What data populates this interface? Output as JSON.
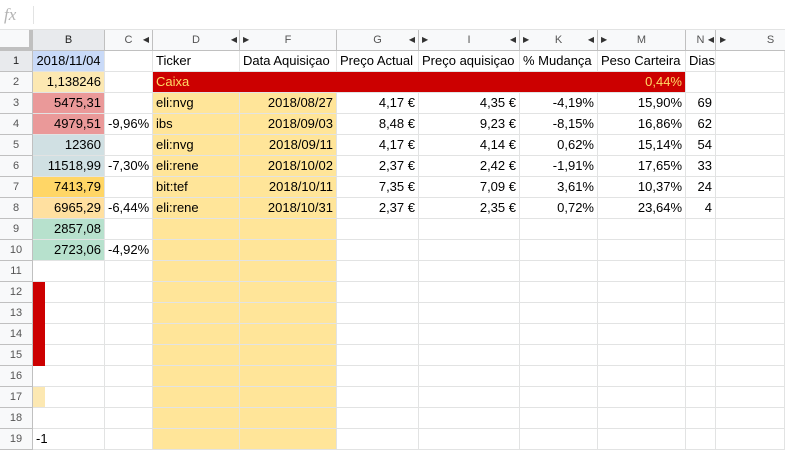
{
  "formula_bar": {
    "fx_label": "fx",
    "value": ""
  },
  "columns": [
    "B",
    "C",
    "D",
    "F",
    "G",
    "I",
    "K",
    "M",
    "N",
    "S"
  ],
  "rows": [
    "1",
    "2",
    "3",
    "4",
    "5",
    "6",
    "7",
    "8",
    "9",
    "10",
    "11",
    "12",
    "13",
    "14",
    "15",
    "16",
    "17",
    "18",
    "19"
  ],
  "colors": {
    "header_fill": "#f8f9fa",
    "red_band": "#cc0000",
    "yellow_text": "#ffd966",
    "light_yellow": "#ffe599",
    "beige": "#fce8b2",
    "green": "#b7e1cd",
    "pink": "#ea9999",
    "grey_blue": "#d0e0e3",
    "orange": "#ffd666",
    "light_orange": "#ffe0a0"
  },
  "col_b": [
    "2018/11/04",
    "1,138246",
    "5475,31",
    "4979,51",
    "12360",
    "11518,99",
    "7413,79",
    "6965,29",
    "2857,08",
    "2723,06",
    "",
    "",
    "",
    "",
    "",
    "",
    "",
    "",
    "-1"
  ],
  "col_c": [
    "",
    "",
    "",
    "-9,96%",
    "",
    "-7,30%",
    "",
    "-6,44%",
    "",
    "-4,92%"
  ],
  "headers": {
    "ticker": "Ticker",
    "data": "Data Aquisiçao",
    "preco_actual": "Preço Actual",
    "preco_aquisicao": "Preço aquisiçao",
    "mudanca": "% Mudança",
    "peso": "Peso Carteira",
    "dias": "Dias"
  },
  "caixa": {
    "label": "Caixa",
    "peso": "0,44%"
  },
  "rows_data": [
    {
      "ticker": "eli:nvg",
      "data": "2018/08/27",
      "preco_actual": "4,17 €",
      "preco_aquisicao": "4,35 €",
      "mudanca": "-4,19%",
      "peso": "15,90%",
      "dias": "69"
    },
    {
      "ticker": "ibs",
      "data": "2018/09/03",
      "preco_actual": "8,48 €",
      "preco_aquisicao": "9,23 €",
      "mudanca": "-8,15%",
      "peso": "16,86%",
      "dias": "62"
    },
    {
      "ticker": "eli:nvg",
      "data": "2018/09/11",
      "preco_actual": "4,17 €",
      "preco_aquisicao": "4,14 €",
      "mudanca": "0,62%",
      "peso": "15,14%",
      "dias": "54"
    },
    {
      "ticker": "eli:rene",
      "data": "2018/10/02",
      "preco_actual": "2,37 €",
      "preco_aquisicao": "2,42 €",
      "mudanca": "-1,91%",
      "peso": "17,65%",
      "dias": "33"
    },
    {
      "ticker": "bit:tef",
      "data": "2018/10/11",
      "preco_actual": "7,35 €",
      "preco_aquisicao": "7,09 €",
      "mudanca": "3,61%",
      "peso": "10,37%",
      "dias": "24"
    },
    {
      "ticker": "eli:rene",
      "data": "2018/10/31",
      "preco_actual": "2,37 €",
      "preco_aquisicao": "2,35 €",
      "mudanca": "0,72%",
      "peso": "23,64%",
      "dias": "4"
    }
  ]
}
